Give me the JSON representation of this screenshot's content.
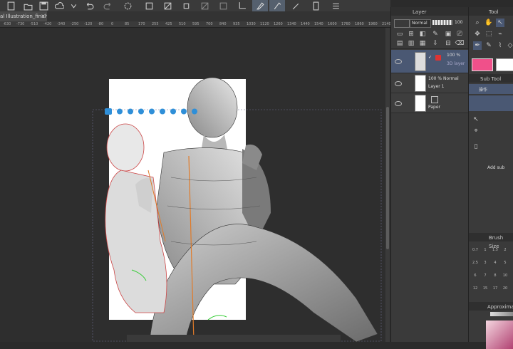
{
  "document": {
    "tab_label": "al Illustration_final*",
    "close_glyph": "×"
  },
  "ruler": {
    "labels": [
      "-630",
      "-730",
      "-510",
      "-420",
      "-340",
      "-250",
      "-120",
      "-80",
      "0",
      "85",
      "170",
      "255",
      "425",
      "510",
      "595",
      "700",
      "840",
      "935",
      "1030",
      "1120",
      "1260",
      "1340",
      "1440",
      "1540",
      "1600",
      "1760",
      "1860",
      "1960",
      "2140"
    ]
  },
  "layer_panel": {
    "title": "Layer",
    "blend_mode": "Normal",
    "opacity": "100",
    "layers": [
      {
        "percent": "100 %",
        "mode_sub": "3D layer",
        "name": ""
      },
      {
        "percent": "100 % Normal",
        "name": "Layer 1"
      },
      {
        "percent": "",
        "name": "Paper"
      }
    ]
  },
  "tool_panel": {
    "title": "Tool",
    "sub_tool_title": "Sub Tool",
    "sub_tool_operation": "操作",
    "add_sub_label": "Add sub",
    "brush_size_title": "Brush Size",
    "approx_title": "Approximat",
    "brush_sizes": [
      "0.7",
      "1",
      "1.5",
      "2",
      "2.5",
      "3",
      "4",
      "5",
      "6",
      "7",
      "8",
      "10",
      "12",
      "15",
      "17",
      "20"
    ],
    "colors": {
      "main": "#f0508a",
      "sub": "#ffffff",
      "accent": "#4a5873"
    }
  },
  "pose_toolbar": {
    "icons": [
      "move-camera-icon",
      "pan-icon",
      "rotate-icon",
      "zoom-icon",
      "ground-icon",
      "camera-icon",
      "reset-icon",
      "settings-icon",
      "link-icon"
    ]
  }
}
